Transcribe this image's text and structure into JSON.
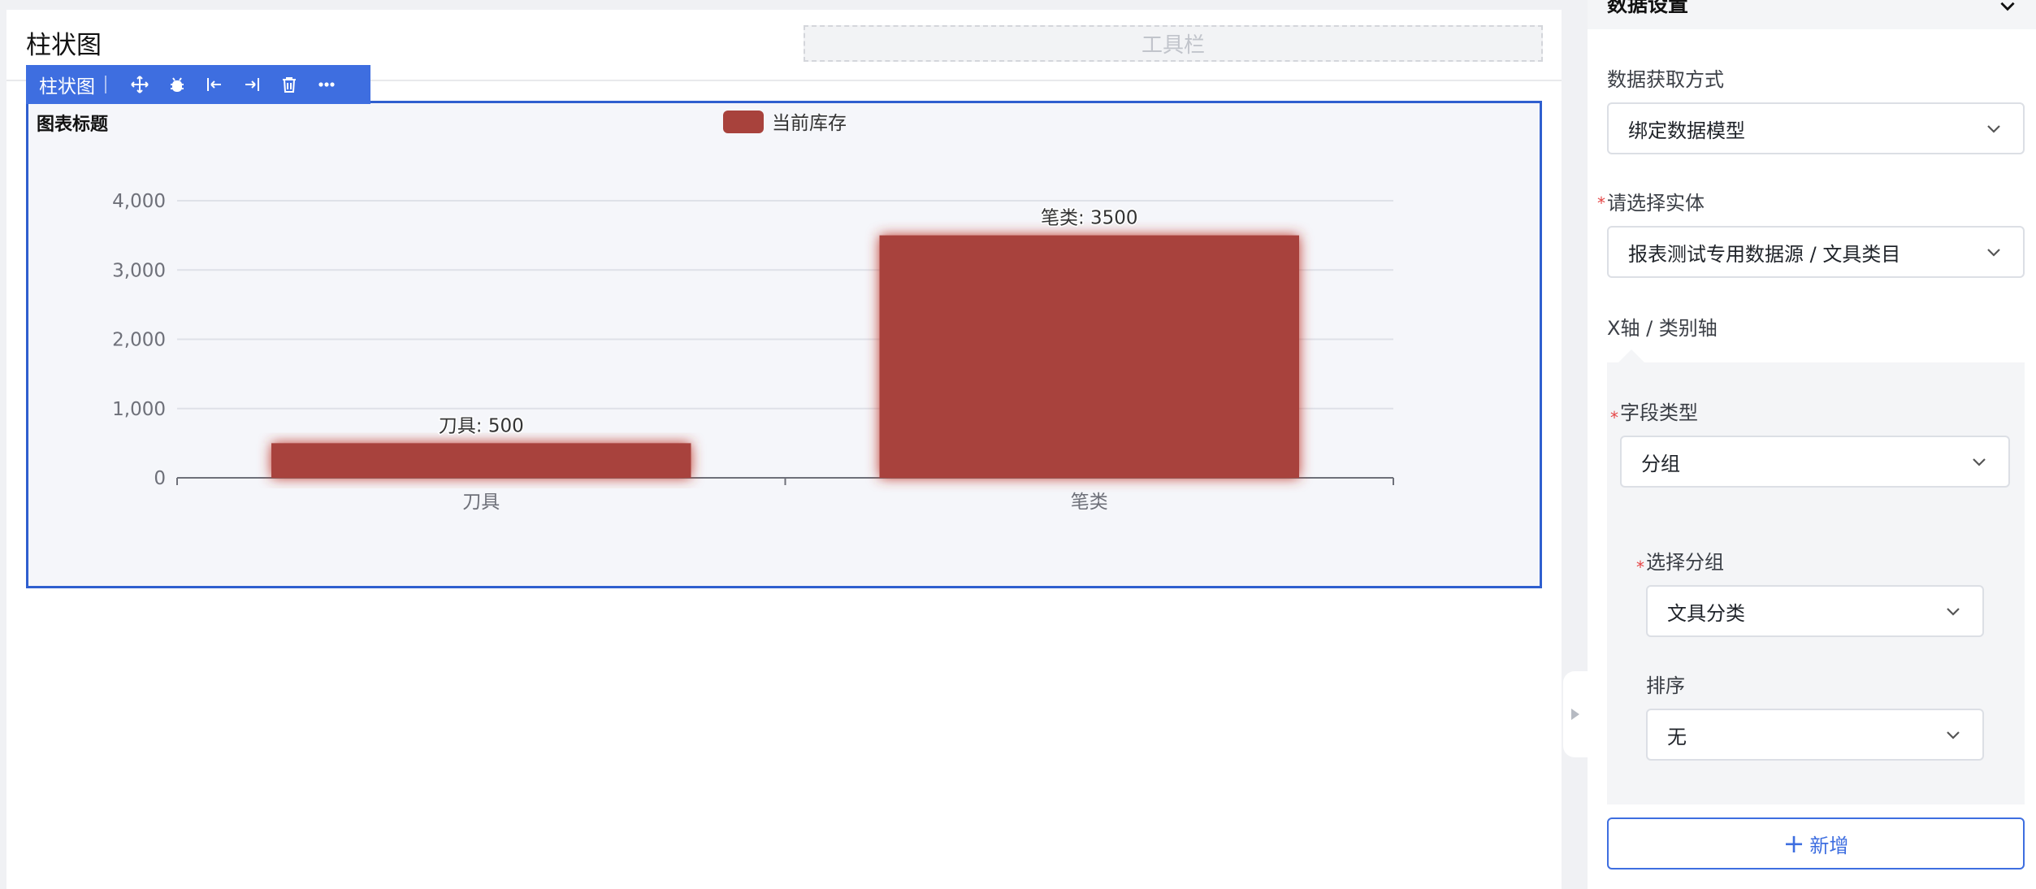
{
  "page": {
    "title": "柱状图",
    "toolbar_placeholder": "工具栏"
  },
  "component_toolbar": {
    "title": "柱状图",
    "icons": [
      "move-icon",
      "bug-icon",
      "align-left-icon",
      "align-right-icon",
      "delete-icon",
      "more-icon"
    ]
  },
  "chart_data": {
    "type": "bar",
    "title": "图表标题",
    "categories": [
      "刀具",
      "笔类"
    ],
    "series": [
      {
        "name": "当前库存",
        "values": [
          500,
          3500
        ]
      }
    ],
    "data_labels": [
      "刀具: 500",
      "笔类: 3500"
    ],
    "yticks": [
      "0",
      "1,000",
      "2,000",
      "3,000",
      "4,000"
    ],
    "ylim": [
      0,
      4000
    ],
    "grid": true,
    "legend_position": "top-center",
    "color": "#a8423c"
  },
  "panel": {
    "header_title": "数据设置",
    "data_source_label": "数据获取方式",
    "data_source_value": "绑定数据模型",
    "entity_label": "请选择实体",
    "entity_value": "报表测试专用数据源 / 文具类目",
    "xaxis_label": "X轴 / 类别轴",
    "field_type_label": "字段类型",
    "field_type_value": "分组",
    "group_label": "选择分组",
    "group_value": "文具分类",
    "sort_label": "排序",
    "sort_value": "无",
    "add_label": "新增",
    "required_mark": "*",
    "accent_color": "#3e6ee0"
  }
}
